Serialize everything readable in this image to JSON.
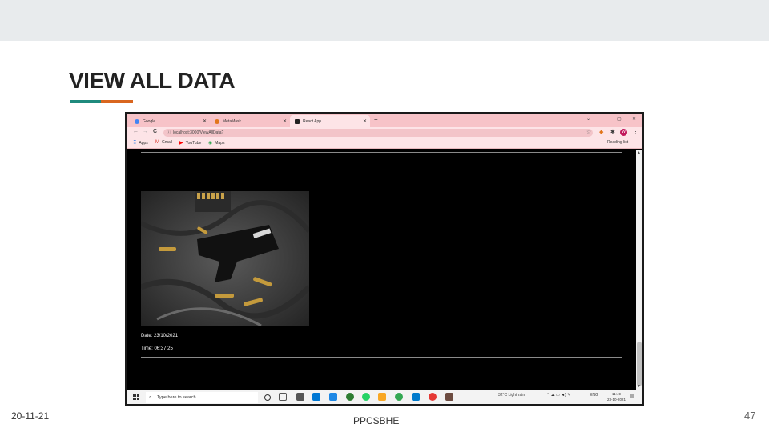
{
  "slide": {
    "title": "VIEW ALL DATA",
    "footer_date": "20-11-21",
    "footer_center": "PPCSBHE",
    "page_number": "47",
    "accent_colors": [
      "#1f8a7d",
      "#d9661f"
    ]
  },
  "browser": {
    "tabs": [
      {
        "label": "Google",
        "icon": "google-icon"
      },
      {
        "label": "MetaMask",
        "icon": "metamask-fox-icon"
      },
      {
        "label": "React App",
        "icon": "react-icon"
      }
    ],
    "new_tab": "+",
    "window_controls": {
      "chevron": "⌄",
      "minimize": "–",
      "maximize": "▢",
      "close": "✕"
    },
    "url": "localhost:3000/ViewAllData?",
    "nav": {
      "back": "←",
      "forward": "→",
      "reload": "C"
    },
    "bookmarks": [
      {
        "label": "Apps",
        "icon": "apps-grid-icon"
      },
      {
        "label": "Gmail",
        "icon": "gmail-icon"
      },
      {
        "label": "YouTube",
        "icon": "youtube-icon"
      },
      {
        "label": "Maps",
        "icon": "maps-icon"
      }
    ],
    "reading_list": "Reading list",
    "profile_initial": "W"
  },
  "content": {
    "date": "Date: 23/10/2021",
    "time": "Time: 06:37:25"
  },
  "taskbar": {
    "search_placeholder": "Type here to search",
    "weather": "32°C  Light rain",
    "language": "ENG",
    "clock_time": "11:49",
    "clock_date": "23-10-2021"
  }
}
